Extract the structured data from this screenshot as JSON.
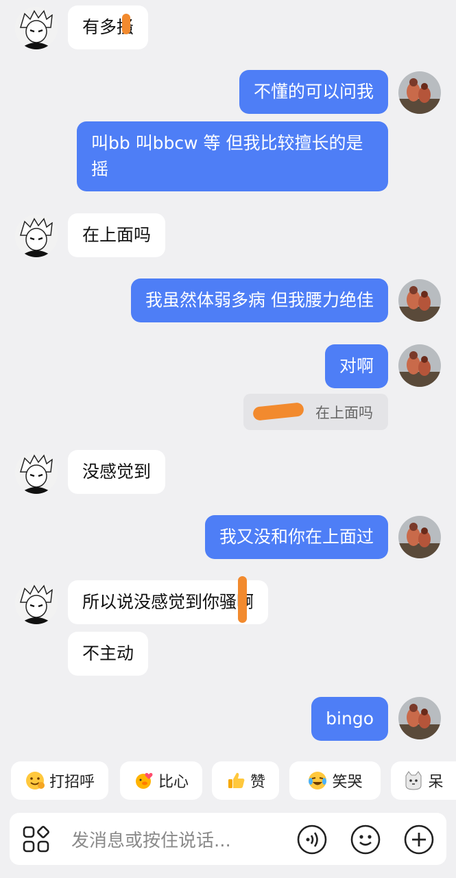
{
  "messages": [
    {
      "side": "in",
      "text": "有多搔"
    },
    {
      "side": "out",
      "text": "不懂的可以问我"
    },
    {
      "side": "out",
      "text": "叫bb 叫bbcw 等 但我比较擅长的是 摇"
    },
    {
      "side": "in",
      "text": "在上面吗"
    },
    {
      "side": "out",
      "text": "我虽然体弱多病 但我腰力绝佳"
    },
    {
      "side": "out",
      "text": "对啊"
    },
    {
      "side": "in",
      "text": "没感觉到"
    },
    {
      "side": "out",
      "text": "我又没和你在上面过"
    },
    {
      "side": "in",
      "text": "所以说没感觉到你骚啊"
    },
    {
      "side": "in",
      "text": "不主动"
    },
    {
      "side": "out",
      "text": "bingo"
    }
  ],
  "quoted_reply": {
    "text": "在上面吗"
  },
  "quick_replies": [
    {
      "icon": "smile-wave-icon",
      "label": "打招呼"
    },
    {
      "icon": "heart-duck-icon",
      "label": "比心"
    },
    {
      "icon": "thumbs-up-icon",
      "label": "赞"
    },
    {
      "icon": "laugh-cry-icon",
      "label": "笑哭"
    },
    {
      "icon": "cat-face-icon",
      "label": "呆"
    }
  ],
  "input": {
    "placeholder": "发消息或按住说话..."
  },
  "colors": {
    "outgoing_bubble": "#4e7ef6",
    "incoming_bubble": "#ffffff",
    "background": "#f0f0f2",
    "redaction": "#f28a2e"
  }
}
